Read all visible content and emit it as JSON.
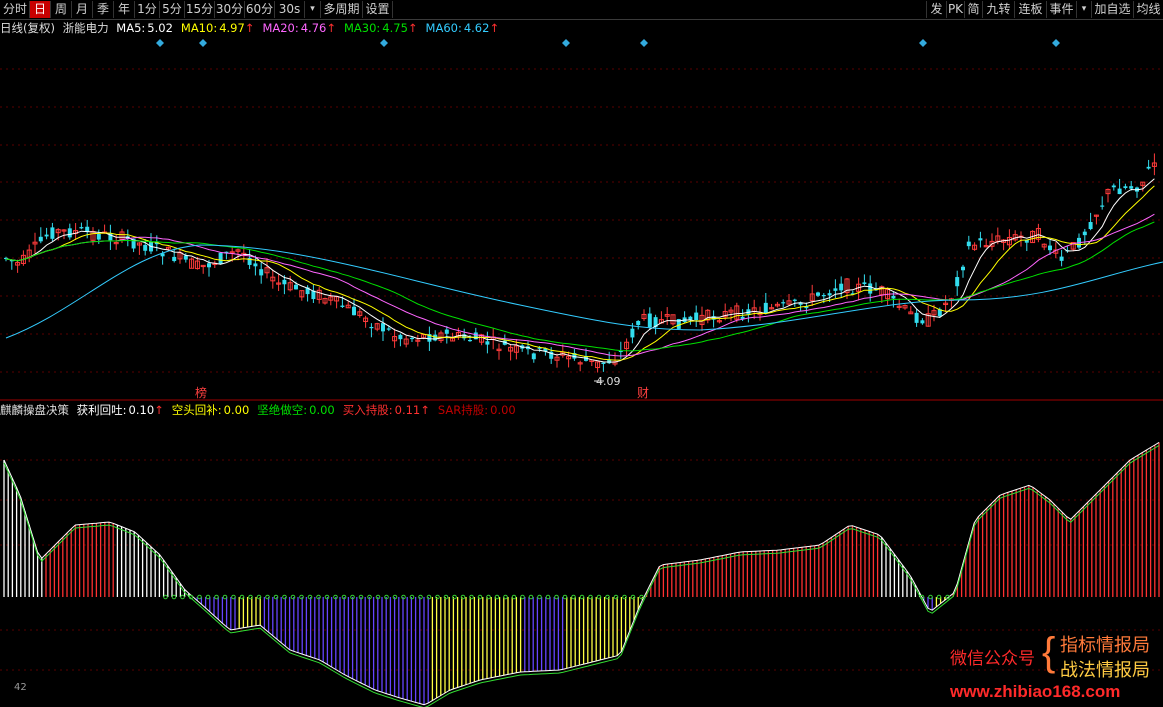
{
  "toolbar": {
    "left": [
      "分时",
      "日",
      "周",
      "月",
      "季",
      "年",
      "1分",
      "5分",
      "15分",
      "30分",
      "60分",
      "30s",
      "▾",
      "多周期",
      "设置"
    ],
    "active": "日",
    "right": [
      "发",
      "PK",
      "简",
      "九转",
      "连板",
      "事件",
      "▾",
      "加自选",
      "均线"
    ]
  },
  "main": {
    "title": "日线(复权)",
    "stock": "浙能电力",
    "ma": [
      {
        "label": "MA5:",
        "value": "5.02",
        "arrow": "",
        "color": "#ffffff"
      },
      {
        "label": "MA10:",
        "value": "4.97",
        "arrow": "↑",
        "color": "#ffff00"
      },
      {
        "label": "MA20:",
        "value": "4.76",
        "arrow": "↑",
        "color": "#ff66ff"
      },
      {
        "label": "MA30:",
        "value": "4.75",
        "arrow": "↑",
        "color": "#00e000"
      },
      {
        "label": "MA60:",
        "value": "4.62",
        "arrow": "↑",
        "color": "#33ccff"
      }
    ],
    "low_label": "4.09",
    "tag_bang": "榜",
    "tag_cai": "财"
  },
  "indicator": {
    "name": "麒麟操盘决策",
    "items": [
      {
        "label": "获利回吐:",
        "value": "0.10",
        "arrow": "↑",
        "color": "#ffffff"
      },
      {
        "label": "空头回补:",
        "value": "0.00",
        "arrow": "",
        "color": "#ffff00"
      },
      {
        "label": "坚绝做空:",
        "value": "0.00",
        "arrow": "",
        "color": "#00e000"
      },
      {
        "label": "买入持股:",
        "value": "0.11",
        "arrow": "↑",
        "color": "#ff3030"
      },
      {
        "label": "SAR持股:",
        "value": "0.00",
        "arrow": "",
        "color": "#c00000"
      }
    ],
    "axis_value": "42"
  },
  "watermark": {
    "wechat": "微信公众号",
    "line1": "指标情报局",
    "line2": "战法情报局",
    "url": "www.zhibiao168.com"
  },
  "colors": {
    "up": "#ff3b3b",
    "down": "#33ddee",
    "bg": "#000000",
    "grid": "#7a0000",
    "active_tab": "#c80000"
  }
}
